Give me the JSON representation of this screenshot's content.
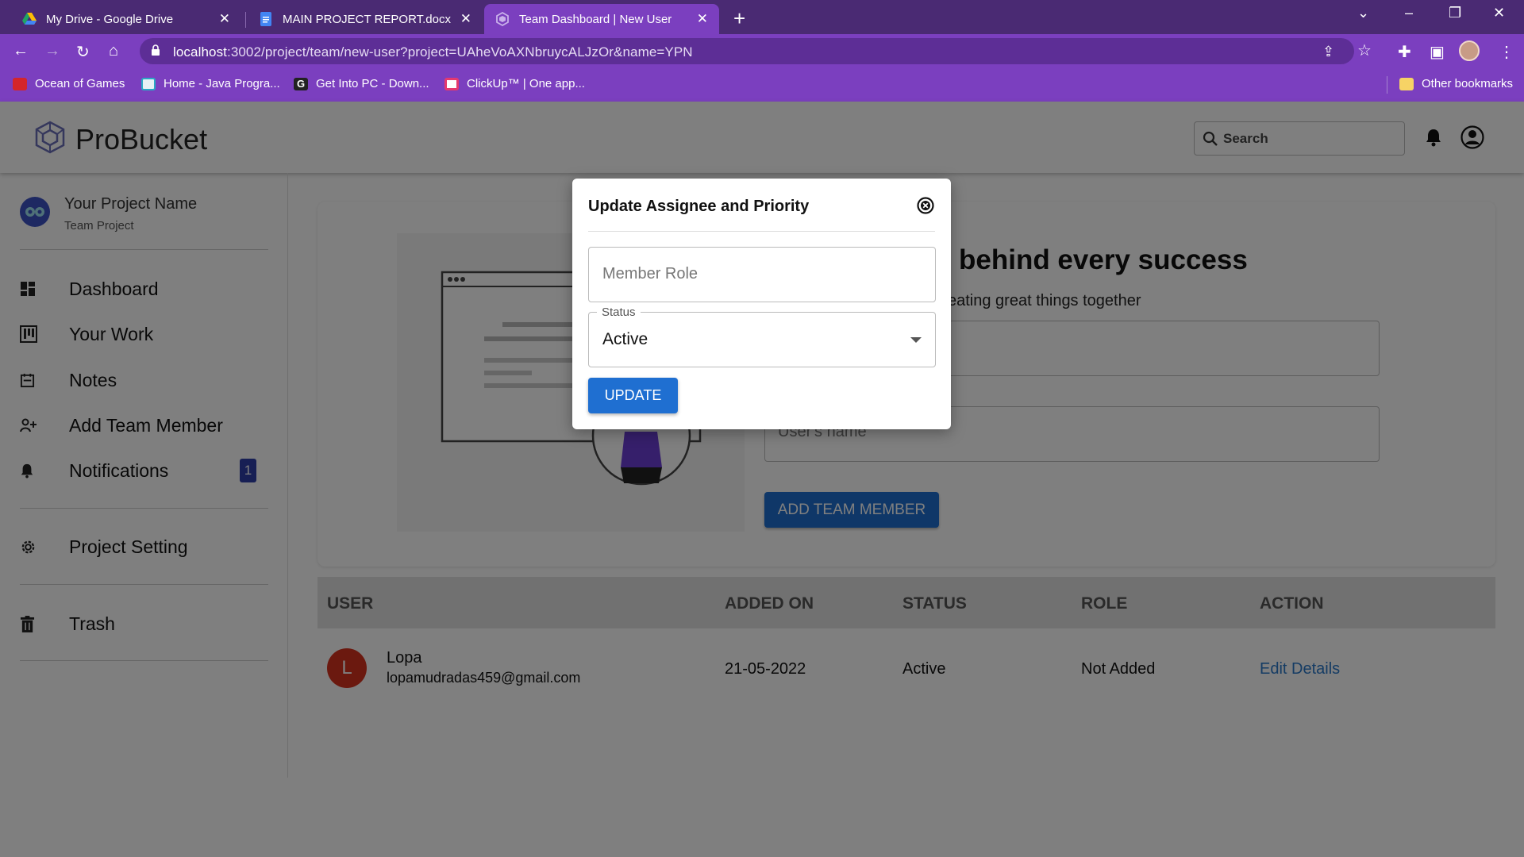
{
  "browser": {
    "tabs": [
      {
        "title": "My Drive - Google Drive",
        "active": false
      },
      {
        "title": "MAIN PROJECT REPORT.docx - G",
        "active": false
      },
      {
        "title": "Team Dashboard | New User",
        "active": true
      }
    ],
    "url_host": "localhost",
    "url_rest": ":3002/project/team/new-user?project=UAheVoAXNbruycALJzOr&name=YPN",
    "bookmarks": [
      "Ocean of Games",
      "Home - Java Progra...",
      "Get Into PC - Down...",
      "ClickUp™ | One app..."
    ],
    "other_bookmarks": "Other bookmarks"
  },
  "app": {
    "brand": "ProBucket",
    "search_placeholder": "Search"
  },
  "sidebar": {
    "project_name": "Your Project Name",
    "project_type": "Team Project",
    "nav": [
      {
        "label": "Dashboard",
        "icon": "dashboard-icon"
      },
      {
        "label": "Your Work",
        "icon": "kanban-icon"
      },
      {
        "label": "Notes",
        "icon": "calendar-icon"
      },
      {
        "label": "Add Team Member",
        "icon": "person-add-icon"
      },
      {
        "label": "Notifications",
        "icon": "bell-icon",
        "badge": "1"
      },
      {
        "label": "Project Setting",
        "icon": "gear-icon"
      },
      {
        "label": "Trash",
        "icon": "trash-icon"
      }
    ]
  },
  "main": {
    "hero_title": "behind every success",
    "hero_subtitle": "eating great things together",
    "name_placeholder": "User's name",
    "add_button": "ADD TEAM MEMBER"
  },
  "table": {
    "columns": [
      "USER",
      "ADDED ON",
      "STATUS",
      "ROLE",
      "ACTION"
    ],
    "rows": [
      {
        "initial": "L",
        "name": "Lopa",
        "email": "lopamudradas459@gmail.com",
        "added_on": "21-05-2022",
        "status": "Active",
        "role": "Not Added",
        "action": "Edit Details"
      }
    ]
  },
  "modal": {
    "title": "Update Assignee and Priority",
    "role_placeholder": "Member Role",
    "status_label": "Status",
    "status_value": "Active",
    "update_label": "UPDATE"
  },
  "colors": {
    "browser_frame": "#7b3fbf",
    "primary_button": "#1f6fd1",
    "avatar": "#d6321e",
    "link": "#2b78c8",
    "badge": "#2f3ea8"
  }
}
